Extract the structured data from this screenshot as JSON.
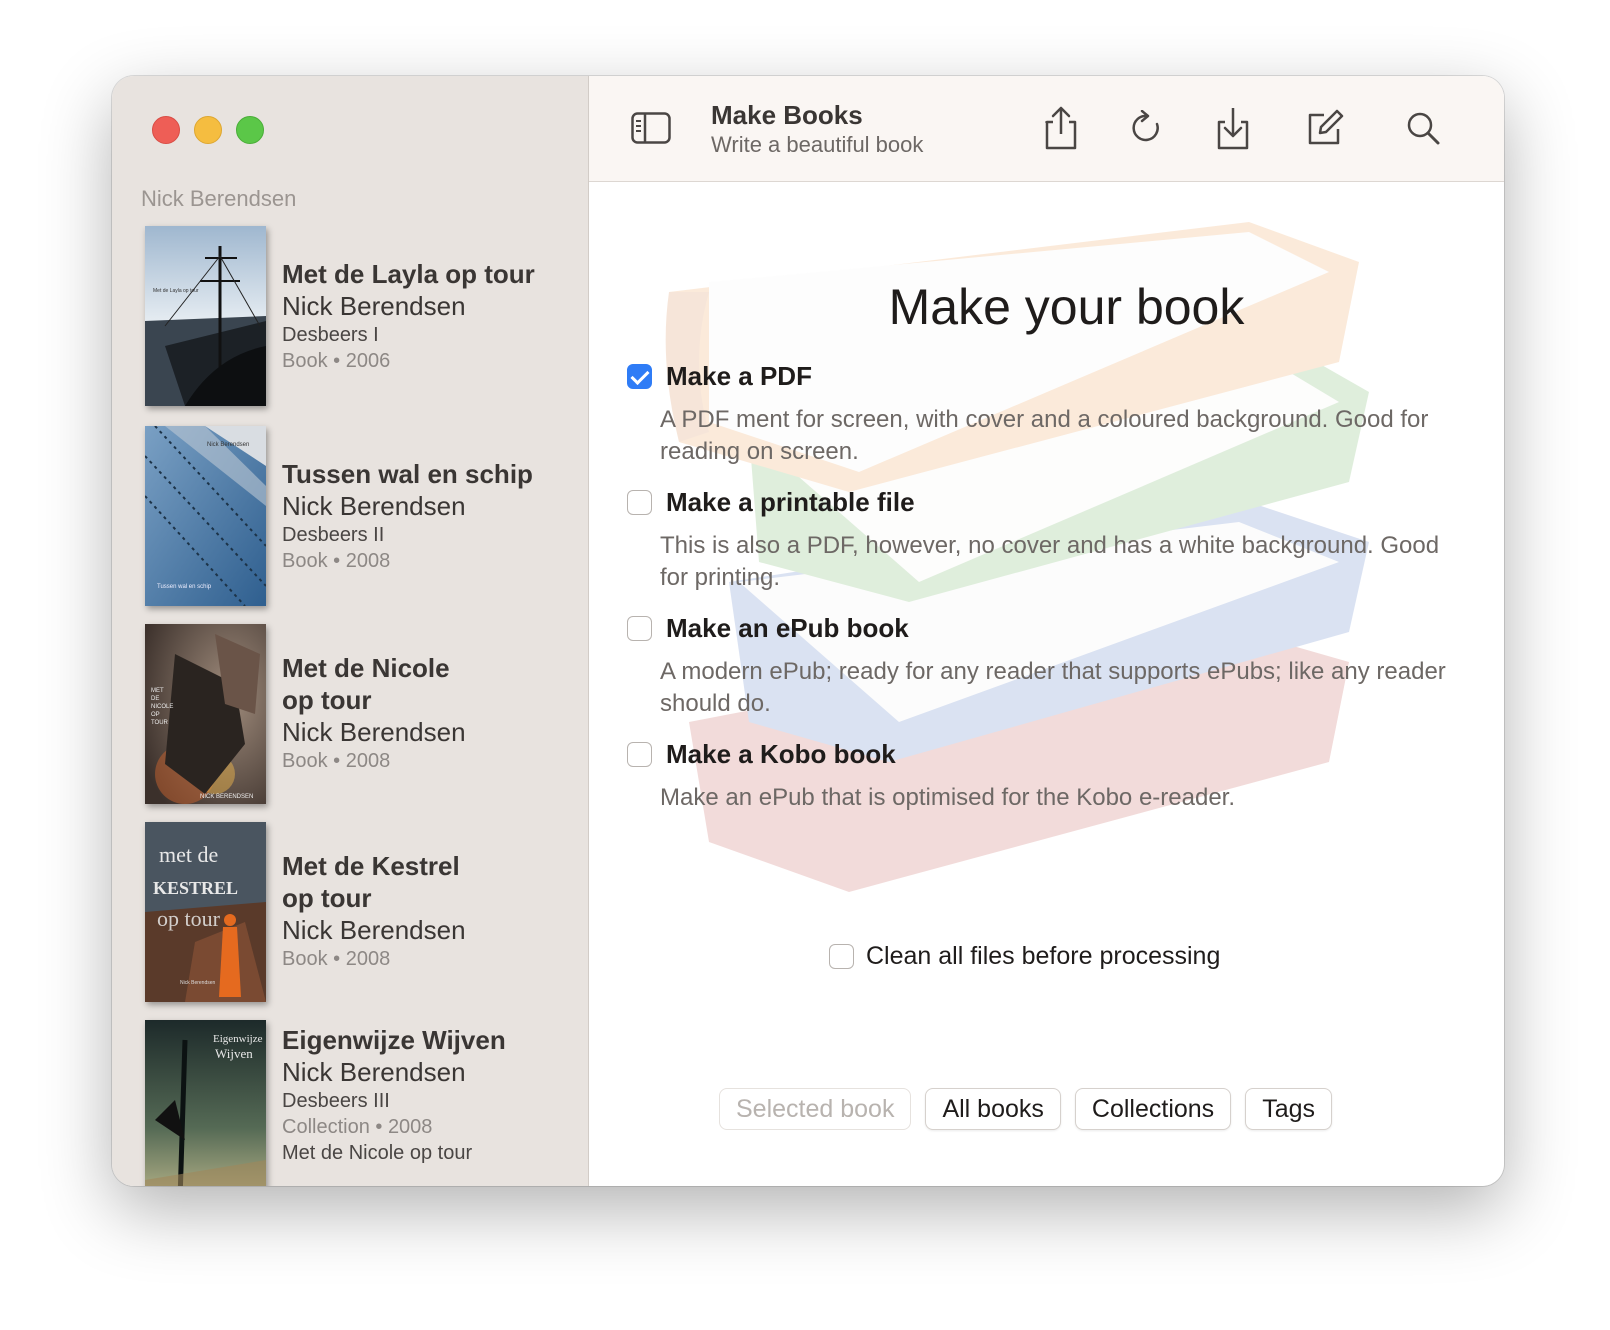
{
  "app": {
    "title": "Make Books",
    "subtitle": "Write a beautiful book"
  },
  "toolbar": {
    "icons": [
      "sidebar-toggle-icon",
      "share-icon",
      "refresh-icon",
      "download-icon",
      "compose-icon",
      "search-icon"
    ]
  },
  "sidebar": {
    "section_label": "Nick Berendsen",
    "books": [
      {
        "title": "Met de Layla op tour",
        "author": "Nick Berendsen",
        "series": "Desbeers I",
        "meta": "Book • 2006"
      },
      {
        "title": "Tussen wal en schip",
        "author": "Nick Berendsen",
        "series": "Desbeers II",
        "meta": "Book • 2008"
      },
      {
        "title_line1": "Met de Nicole",
        "title_line2": "op tour",
        "author": "Nick Berendsen",
        "meta": "Book • 2008"
      },
      {
        "title_line1": "Met de Kestrel",
        "title_line2": "op tour",
        "author": "Nick Berendsen",
        "meta": "Book • 2008"
      },
      {
        "title": "Eigenwijze Wijven",
        "author": "Nick Berendsen",
        "series": "Desbeers III",
        "meta": "Collection • 2008",
        "extra": "Met de Nicole op tour"
      }
    ]
  },
  "covers": {
    "layla": {
      "caption": "Met de Layla op tour"
    },
    "tussen": {
      "top": "Nick Berendsen",
      "bottom": "Tussen wal en schip"
    },
    "nicole": {
      "line1": "MET",
      "line2": "DE",
      "line3": "NICOLE",
      "line4": "OP",
      "line5": "TOUR",
      "author": "NICK BERENDSEN"
    },
    "kestrel": {
      "line1": "met de",
      "line2": "KESTREL",
      "line3": "op tour",
      "author": "Nick Berendsen"
    },
    "eigenwijze": {
      "line1": "Eigenwijze",
      "line2": "Wijven"
    }
  },
  "main": {
    "heading": "Make your book",
    "options": [
      {
        "label": "Make a PDF",
        "checked": true,
        "desc": "A PDF ment for screen, with cover and a coloured background. Good for reading on screen."
      },
      {
        "label": "Make a printable file",
        "checked": false,
        "desc": "This is also a PDF, however, no cover and has a white background. Good for printing."
      },
      {
        "label": "Make an ePub book",
        "checked": false,
        "desc": "A modern ePub; ready for any reader that supports ePubs; like any reader should do."
      },
      {
        "label": "Make a Kobo book",
        "checked": false,
        "desc": "Make an ePub that is optimised for the Kobo e-reader."
      }
    ],
    "clean": {
      "label": "Clean all files before processing",
      "checked": false
    }
  },
  "segments": [
    {
      "label": "Selected book",
      "enabled": false
    },
    {
      "label": "All books",
      "enabled": true
    },
    {
      "label": "Collections",
      "enabled": true
    },
    {
      "label": "Tags",
      "enabled": true
    }
  ],
  "colors": {
    "sidebar_bg": "#e8e3df",
    "toolbar_bg": "#faf6f3",
    "accent": "#2f7cf6"
  }
}
